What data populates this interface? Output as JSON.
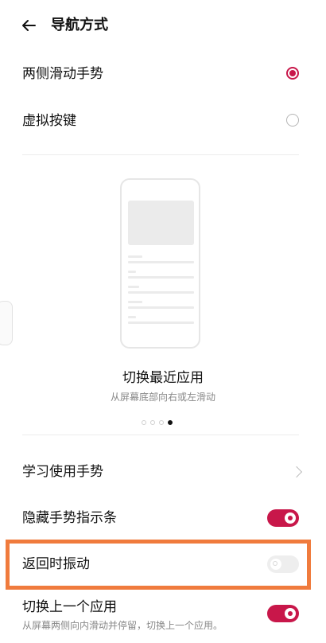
{
  "header": {
    "title": "导航方式"
  },
  "mode_options": [
    {
      "label": "两侧滑动手势",
      "selected": true
    },
    {
      "label": "虚拟按键",
      "selected": false
    }
  ],
  "preview": {
    "title": "切换最近应用",
    "subtitle": "从屏幕底部向右或左滑动",
    "page_count": 4,
    "active_page": 4
  },
  "settings": {
    "learn_gestures": {
      "label": "学习使用手势"
    },
    "hide_indicator": {
      "label": "隐藏手势指示条",
      "state": "on"
    },
    "return_vibration": {
      "label": "返回时振动",
      "state": "off-disabled"
    },
    "switch_previous": {
      "label": "切换上一个应用",
      "description": "从屏幕两侧向内滑动并停留，切换上一个应用。",
      "state": "on"
    }
  },
  "colors": {
    "accent": "#c8174a",
    "highlight": "#f07b3d"
  }
}
